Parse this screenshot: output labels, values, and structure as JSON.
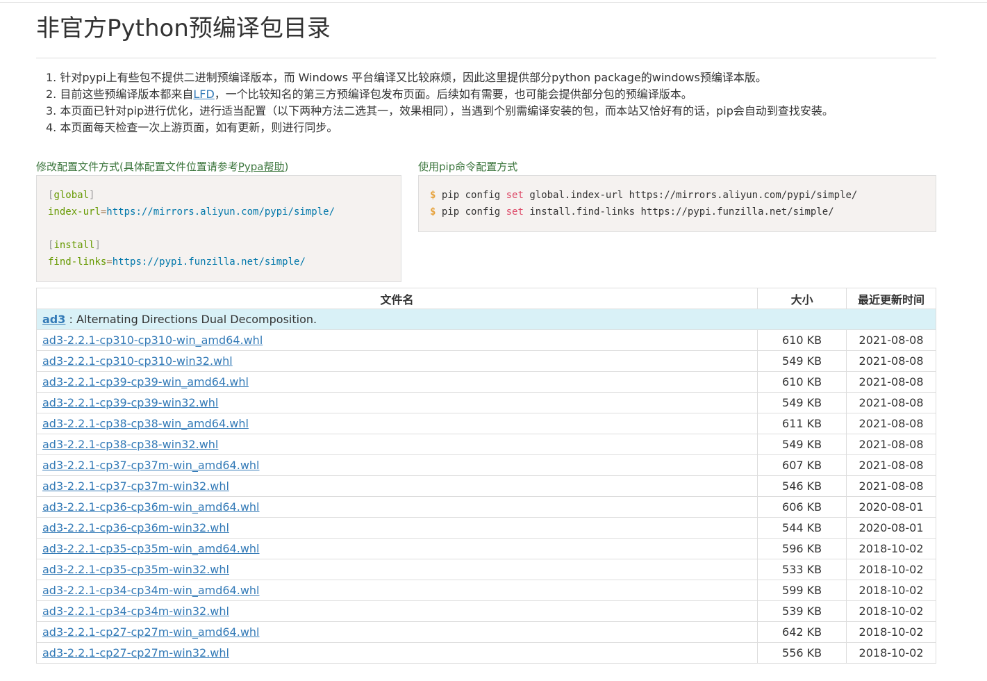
{
  "page": {
    "title": "非官方Python预编译包目录",
    "notes": [
      {
        "prefix": "1. 针对pypi上有些包不提供二进制预编译版本，而 Windows 平台编译又比较麻烦，因此这里提供部分python package的windows预编译本版。",
        "link": "",
        "suffix": ""
      },
      {
        "prefix": "2. 目前这些预编译版本都来自",
        "link": "LFD",
        "suffix": "，一个比较知名的第三方预编译包发布页面。后续如有需要，也可能会提供部分包的预编译版本。"
      },
      {
        "prefix": "3. 本页面已针对pip进行优化，进行适当配置（以下两种方法二选其一，效果相同），当遇到个别需编译安装的包，而本站又恰好有的话，pip会自动到查找安装。",
        "link": "",
        "suffix": ""
      },
      {
        "prefix": "4. 本页面每天检查一次上游页面，如有更新，则进行同步。",
        "link": "",
        "suffix": ""
      }
    ]
  },
  "config": {
    "left_title_prefix": "修改配置文件方式(具体配置文件位置请参考",
    "left_title_link": "Pypa帮助",
    "left_title_suffix": ")",
    "right_title": "使用pip命令配置方式",
    "file_lines": {
      "global_section": "global",
      "index_key": "index-url",
      "index_val": "https://mirrors.aliyun.com/pypi/simple/",
      "install_section": "install",
      "find_key": "find-links",
      "find_val": "https://pypi.funzilla.net/simple/"
    },
    "cmd_lines": [
      {
        "prompt": "$",
        "cmd": "pip config",
        "set": "set",
        "args": "global.index-url https://mirrors.aliyun.com/pypi/simple/"
      },
      {
        "prompt": "$",
        "cmd": "pip config",
        "set": "set",
        "args": "install.find-links https://pypi.funzilla.net/simple/"
      }
    ]
  },
  "table": {
    "headers": {
      "name": "文件名",
      "size": "大小",
      "date": "最近更新时间"
    },
    "package": {
      "name": "ad3",
      "desc": " : Alternating Directions Dual Decomposition."
    },
    "rows": [
      {
        "file": "ad3-2.2.1-cp310-cp310-win_amd64.whl",
        "size": "610 KB",
        "date": "2021-08-08"
      },
      {
        "file": "ad3-2.2.1-cp310-cp310-win32.whl",
        "size": "549 KB",
        "date": "2021-08-08"
      },
      {
        "file": "ad3-2.2.1-cp39-cp39-win_amd64.whl",
        "size": "610 KB",
        "date": "2021-08-08"
      },
      {
        "file": "ad3-2.2.1-cp39-cp39-win32.whl",
        "size": "549 KB",
        "date": "2021-08-08"
      },
      {
        "file": "ad3-2.2.1-cp38-cp38-win_amd64.whl",
        "size": "611 KB",
        "date": "2021-08-08"
      },
      {
        "file": "ad3-2.2.1-cp38-cp38-win32.whl",
        "size": "549 KB",
        "date": "2021-08-08"
      },
      {
        "file": "ad3-2.2.1-cp37-cp37m-win_amd64.whl",
        "size": "607 KB",
        "date": "2021-08-08"
      },
      {
        "file": "ad3-2.2.1-cp37-cp37m-win32.whl",
        "size": "546 KB",
        "date": "2021-08-08"
      },
      {
        "file": "ad3-2.2.1-cp36-cp36m-win_amd64.whl",
        "size": "606 KB",
        "date": "2020-08-01"
      },
      {
        "file": "ad3-2.2.1-cp36-cp36m-win32.whl",
        "size": "544 KB",
        "date": "2020-08-01"
      },
      {
        "file": "ad3-2.2.1-cp35-cp35m-win_amd64.whl",
        "size": "596 KB",
        "date": "2018-10-02"
      },
      {
        "file": "ad3-2.2.1-cp35-cp35m-win32.whl",
        "size": "533 KB",
        "date": "2018-10-02"
      },
      {
        "file": "ad3-2.2.1-cp34-cp34m-win_amd64.whl",
        "size": "599 KB",
        "date": "2018-10-02"
      },
      {
        "file": "ad3-2.2.1-cp34-cp34m-win32.whl",
        "size": "539 KB",
        "date": "2018-10-02"
      },
      {
        "file": "ad3-2.2.1-cp27-cp27m-win_amd64.whl",
        "size": "642 KB",
        "date": "2018-10-02"
      },
      {
        "file": "ad3-2.2.1-cp27-cp27m-win32.whl",
        "size": "556 KB",
        "date": "2018-10-02"
      }
    ]
  },
  "colors": {
    "link": "#337ab7",
    "section_title": "#3c763d",
    "package_row_bg": "#d9f1f7",
    "code_bg": "#f5f2f0"
  }
}
